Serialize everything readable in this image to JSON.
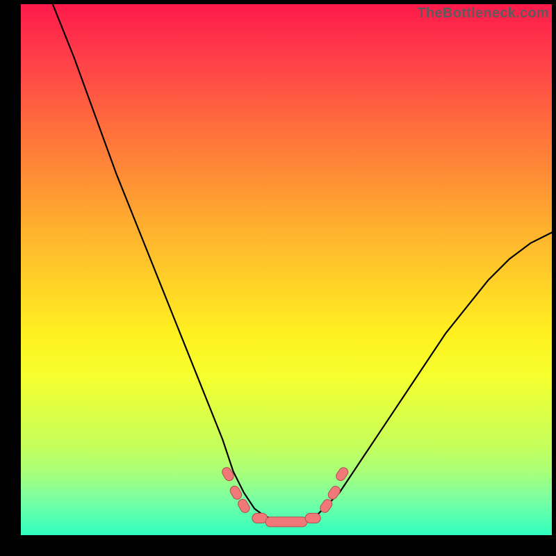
{
  "brand": {
    "watermark": "TheBottleneck.com"
  },
  "colors": {
    "background": "#000000",
    "gradient_top": "#ff1a4b",
    "gradient_bottom": "#2fffc0",
    "curve": "#000000",
    "marker_fill": "#f07878",
    "marker_stroke": "#b24e4e"
  },
  "chart_data": {
    "type": "line",
    "title": "",
    "xlabel": "",
    "ylabel": "",
    "xlim": [
      0,
      100
    ],
    "ylim": [
      0,
      100
    ],
    "grid": false,
    "legend": false,
    "description": "Two-sided bottleneck curve over a red→green vertical gradient. Y encodes bottleneck severity (top=bad, bottom=good). X is a balance position. Curve drops steeply from top-left, flattens near y≈2 over x≈40–58, then rises toward x=100 y≈57. Salmon markers flag the near-optimal valley edges and floor.",
    "series": [
      {
        "name": "bottleneck-curve",
        "x": [
          6,
          10,
          14,
          18,
          22,
          26,
          30,
          34,
          38,
          40,
          42,
          44,
          46,
          48,
          50,
          52,
          54,
          56,
          58,
          60,
          64,
          68,
          72,
          76,
          80,
          84,
          88,
          92,
          96,
          100
        ],
        "y": [
          100,
          90,
          79,
          68,
          58,
          48,
          38,
          28,
          18,
          12,
          8,
          5,
          3.5,
          3,
          2.5,
          2.5,
          3,
          4,
          6,
          8,
          14,
          20,
          26,
          32,
          38,
          43,
          48,
          52,
          55,
          57
        ]
      }
    ],
    "markers": [
      {
        "x": 39.0,
        "y": 11.5,
        "shape": "pill-diag"
      },
      {
        "x": 40.5,
        "y": 8.0,
        "shape": "pill-diag"
      },
      {
        "x": 42.0,
        "y": 5.5,
        "shape": "pill-diag"
      },
      {
        "x": 45.0,
        "y": 3.2,
        "shape": "pill-horiz-short"
      },
      {
        "x": 50.0,
        "y": 2.5,
        "shape": "pill-horiz-long"
      },
      {
        "x": 55.0,
        "y": 3.2,
        "shape": "pill-horiz-short"
      },
      {
        "x": 57.5,
        "y": 5.5,
        "shape": "pill-diag-r"
      },
      {
        "x": 59.0,
        "y": 8.0,
        "shape": "pill-diag-r"
      },
      {
        "x": 60.5,
        "y": 11.5,
        "shape": "pill-diag-r"
      }
    ]
  }
}
